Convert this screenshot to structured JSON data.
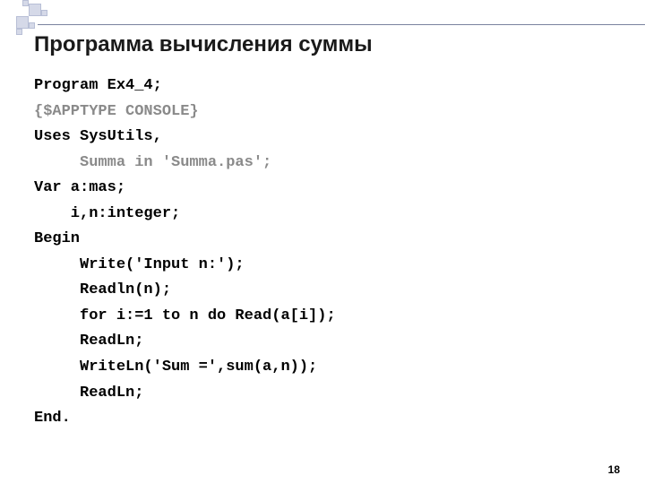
{
  "title": "Программа вычисления суммы",
  "code": {
    "l1": "Program Ex4_4;",
    "l2": "{$APPTYPE CONSOLE}",
    "l3": "Uses SysUtils,",
    "l4": "     Summa in 'Summa.pas';",
    "l5": "Var a:mas;",
    "l6": "    i,n:integer;",
    "l7": "Begin",
    "l8": "     Write('Input n:');",
    "l9": "     Readln(n);",
    "l10": "     for i:=1 to n do Read(a[i]);",
    "l11": "     ReadLn;",
    "l12": "     WriteLn('Sum =',sum(a,n));",
    "l13": "     ReadLn;",
    "l14": "End."
  },
  "page_number": "18"
}
